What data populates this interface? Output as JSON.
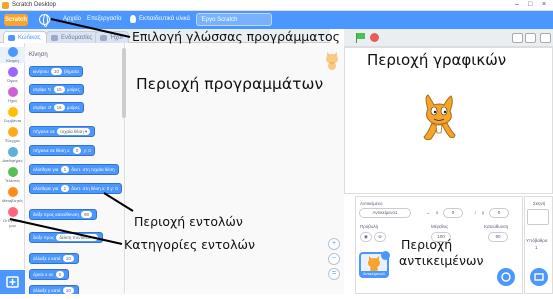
{
  "titlebar": {
    "title": "Scratch Desktop"
  },
  "menubar": {
    "logo": "Scratch",
    "items": [
      "Αρχείο",
      "Επεξεργασία",
      "Εκπαιδευτικά υλικά"
    ],
    "project_title": "Έργο Scratch"
  },
  "tabs": [
    {
      "label": "Κώδικας"
    },
    {
      "label": "Ενδυμασίες"
    },
    {
      "label": "Ήχοι"
    }
  ],
  "categories": [
    {
      "label": "Κίνηση",
      "color": "#4c97ff"
    },
    {
      "label": "Όψεις",
      "color": "#9966ff"
    },
    {
      "label": "Ήχος",
      "color": "#cf63cf"
    },
    {
      "label": "Συμβάντα",
      "color": "#ffbf00"
    },
    {
      "label": "Έλεγχος",
      "color": "#ffab19"
    },
    {
      "label": "Αισθητήρες",
      "color": "#5cb1d6"
    },
    {
      "label": "Τελεστές",
      "color": "#59c059"
    },
    {
      "label": "Μεταβλητές",
      "color": "#ff8c1a"
    },
    {
      "label": "Οι Εντολές μου",
      "color": "#ff6680"
    }
  ],
  "palette": {
    "heading": "Κίνηση",
    "blocks": [
      {
        "pre": "κινήσου",
        "val": "10",
        "post": "βήματα"
      },
      {
        "pre": "στρίψε ↻",
        "val": "15",
        "post": "μοίρες"
      },
      {
        "pre": "στρίψε ↺",
        "val": "15",
        "post": "μοίρες"
      },
      {
        "pre": "πήγαινε σε",
        "val": "τυχαία θέση ▾",
        "post": ""
      },
      {
        "pre": "πήγαινε σε θέση x:",
        "val": "0",
        "post": "y: 0"
      },
      {
        "pre": "ολίσθησε για",
        "val": "1",
        "post": "δευτ. στη τυχαία θέση"
      },
      {
        "pre": "ολίσθησε για",
        "val": "1",
        "post": "δευτ. στη θέση x: 0 y: 0"
      },
      {
        "pre": "δείξε προς κατεύθυνση",
        "val": "90",
        "post": ""
      },
      {
        "pre": "δείξε προς",
        "val": "δείκτη ποντικιού ▾",
        "post": ""
      },
      {
        "pre": "άλλαξε x κατά",
        "val": "10",
        "post": ""
      },
      {
        "pre": "όρισε x σε",
        "val": "0",
        "post": ""
      },
      {
        "pre": "άλλαξε y κατά",
        "val": "10",
        "post": ""
      }
    ]
  },
  "zoom": {
    "in": "+",
    "out": "−",
    "reset": "="
  },
  "sprite_info": {
    "sprite_label": "Αντικείμενο",
    "sprite_name": "Αντικείμενο1",
    "x_label": "x",
    "x_value": "0",
    "y_label": "y",
    "y_value": "0",
    "show_label": "Προβολή",
    "size_label": "Μέγεθος",
    "size_value": "100",
    "direction_label": "Κατεύθυνση",
    "direction_value": "90",
    "thumb_name": "Αντικείμενο1"
  },
  "stage_pane": {
    "label": "Σκηνή",
    "backdrops_label": "Υπόβαθρα",
    "backdrops_count": "1"
  },
  "annotations": {
    "language": "Επιλογή γλώσσας προγράμματος",
    "graphics": "Περιοχή γραφικών",
    "programs": "Περιοχή προγραμμάτων",
    "commands": "Περιοχή εντολών",
    "categories": "Κατηγορίες εντολών",
    "objects_1": "Περιοχή",
    "objects_2": "αντικειμένων"
  },
  "colors": {
    "menubar": "#4c97ff",
    "accent": "#4c97ff",
    "annotation": "#111111",
    "scratch_orange": "#f7a42a"
  }
}
